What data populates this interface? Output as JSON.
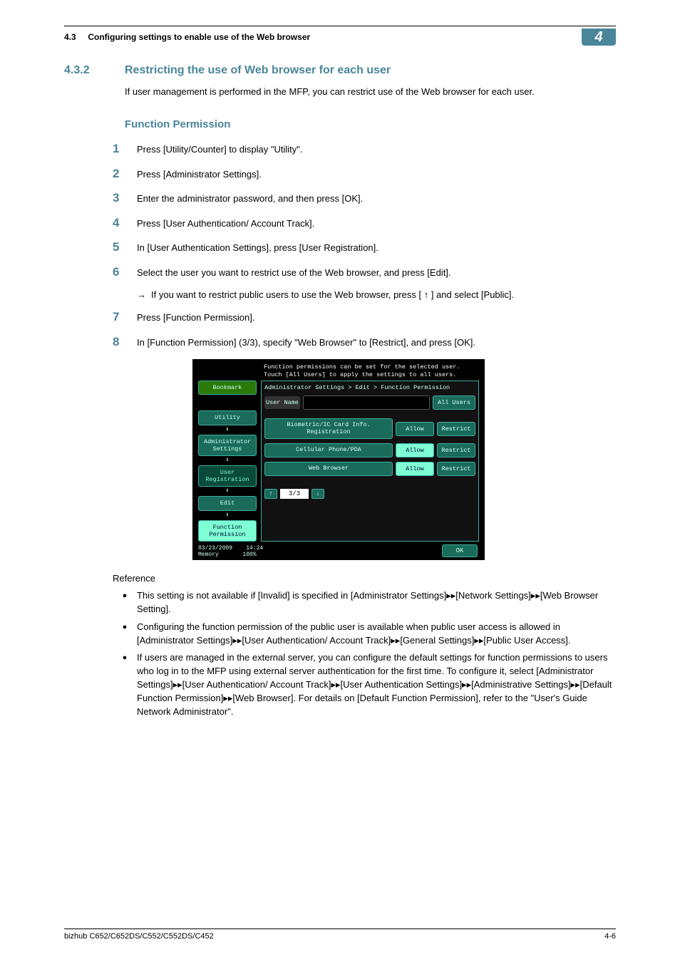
{
  "header": {
    "section_num": "4.3",
    "section_title": "Configuring settings to enable use of the Web browser",
    "chapter_badge": "4"
  },
  "section": {
    "number": "4.3.2",
    "title": "Restricting the use of Web browser for each user",
    "intro": "If user management is performed in the MFP, you can restrict use of the Web browser for each user."
  },
  "subheading": "Function Permission",
  "steps": [
    {
      "n": "1",
      "t": "Press [Utility/Counter] to display \"Utility\"."
    },
    {
      "n": "2",
      "t": "Press [Administrator Settings]."
    },
    {
      "n": "3",
      "t": "Enter the administrator password, and then press [OK]."
    },
    {
      "n": "4",
      "t": "Press [User Authentication/ Account Track]."
    },
    {
      "n": "5",
      "t": "In [User Authentication Settings], press [User Registration]."
    },
    {
      "n": "6",
      "t": "Select the user you want to restrict use of the Web browser, and press [Edit].",
      "sub": "If you want to restrict public users to use the Web browser, press [ ↑ ] and select [Public]."
    },
    {
      "n": "7",
      "t": "Press [Function Permission]."
    },
    {
      "n": "8",
      "t": "In [Function Permission] (3/3), specify \"Web Browser\" to [Restrict], and press [OK]."
    }
  ],
  "screenshot": {
    "hint1": "Function permissions can be set for the selected user.",
    "hint2": "Touch [All Users] to apply the settings to all users.",
    "side": {
      "bookmark": "Bookmark",
      "utility": "Utility",
      "admin": "Administrator Settings",
      "userreg": "User Registration",
      "edit": "Edit",
      "funcperm": "Function Permission"
    },
    "crumb": "Administrator Settings > Edit > Function Permission",
    "username_label": "User Name",
    "allusers": "All Users",
    "rows": [
      {
        "label": "Biometric/IC Card Info. Registration",
        "a": "Allow",
        "r": "Restrict"
      },
      {
        "label": "Cellular Phone/PDA",
        "a": "Allow",
        "r": "Restrict"
      },
      {
        "label": "Web Browser",
        "a": "Allow",
        "r": "Restrict"
      }
    ],
    "pager": "3/3",
    "date": "03/23/2009",
    "time": "14:24",
    "memory": "Memory",
    "mempct": "100%",
    "ok": "OK"
  },
  "reference": {
    "title": "Reference",
    "items": [
      "This setting is not available if [Invalid] is specified in [Administrator Settings]▸▸[Network Settings]▸▸[Web Browser Setting].",
      "Configuring the function permission of the public user is available when public user access is allowed in [Administrator Settings]▸▸[User Authentication/ Account Track]▸▸[General Settings]▸▸[Public User Access].",
      "If users are managed in the external server, you can configure the default settings for function permissions to users who log in to the MFP using external server authentication for the first time. To configure it, select [Administrator Settings]▸▸[User Authentication/ Account Track]▸▸[User Authentication Settings]▸▸[Administrative Settings]▸▸[Default Function Permission]▸▸[Web Browser]. For details on [Default Function Permission], refer to the \"User's Guide Network Administrator\"."
    ]
  },
  "footer": {
    "left": "bizhub C652/C652DS/C552/C552DS/C452",
    "right": "4-6"
  }
}
